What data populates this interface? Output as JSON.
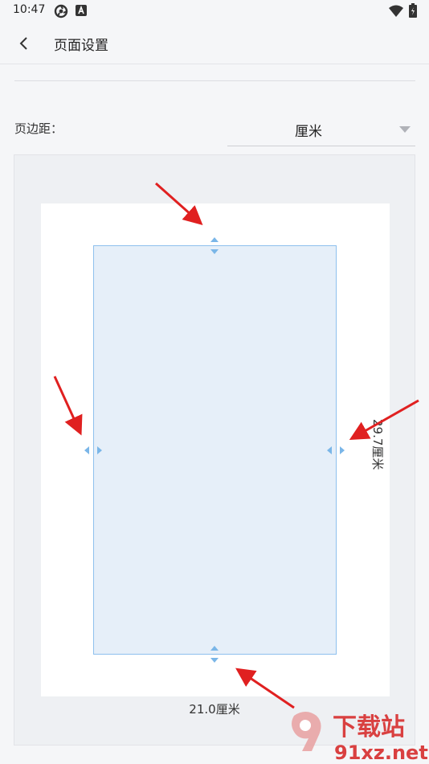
{
  "status_bar": {
    "time": "10:47"
  },
  "app_bar": {
    "title": "页面设置"
  },
  "margins": {
    "label": "页边距：",
    "unit": "厘米"
  },
  "preview": {
    "width_label": "21.0厘米",
    "height_label": "29.7厘米"
  },
  "watermark": {
    "brand": "下载站",
    "domain": "91xz.net"
  },
  "colors": {
    "handle": "#7ab6e8",
    "arrow": "#e02020",
    "content_fill": "#e6eff9"
  }
}
